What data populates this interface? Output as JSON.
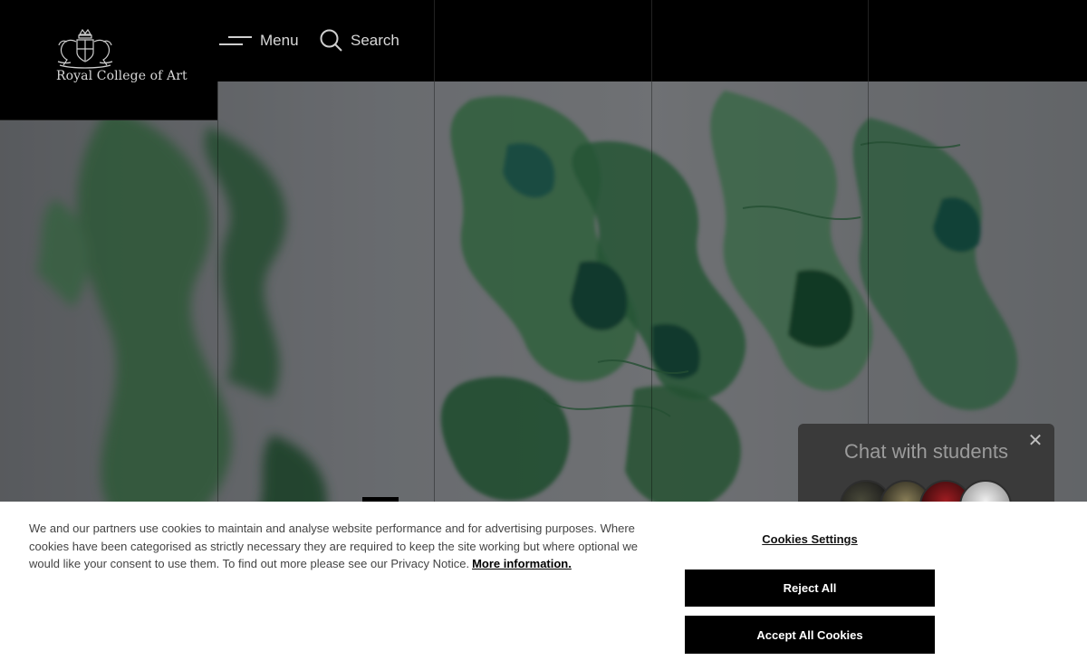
{
  "header": {
    "logo_text": "Royal College of Art",
    "menu_label": "Menu",
    "search_label": "Search"
  },
  "chat": {
    "title": "Chat with students",
    "close_glyph": "✕"
  },
  "cookie_banner": {
    "text": "We and our partners use cookies to maintain and analyse website performance and for advertising purposes. Where cookies have been categorised as strictly necessary they are required to keep the site working but where optional we would like your consent to use them. To find out more please see our Privacy Notice.",
    "more_info_label": "More information.",
    "settings_label": "Cookies Settings",
    "reject_label": "Reject All",
    "accept_label": "Accept All Cookies"
  },
  "icons": {
    "logo": "royal-crest-icon",
    "menu": "hamburger-icon",
    "search": "search-icon",
    "close": "close-icon"
  },
  "colors": {
    "header_bg": "#000000",
    "banner_bg": "#ffffff",
    "button_bg": "#000000",
    "artwork_green": "#3f8a55"
  }
}
